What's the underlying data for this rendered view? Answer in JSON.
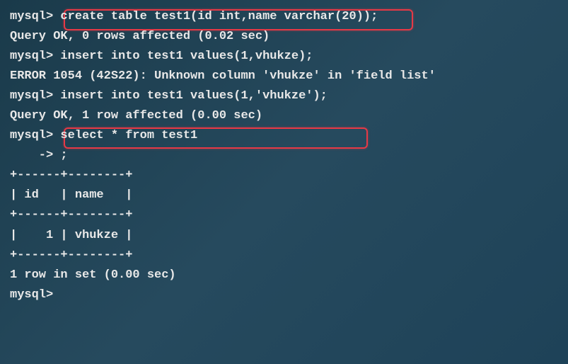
{
  "terminal": {
    "prompt": "mysql>",
    "cont_prompt": "    ->",
    "lines": {
      "l1_cmd": " create table test1(id int,name varchar(20));",
      "l2": "Query OK, 0 rows affected (0.02 sec)",
      "l3": "",
      "l4_cmd": " insert into test1 values(1,vhukze);",
      "l5": "ERROR 1054 (42S22): Unknown column 'vhukze' in 'field list'",
      "l6_cmd": " insert into test1 values(1,'vhukze');",
      "l7": "Query OK, 1 row affected (0.00 sec)",
      "l8": "",
      "l9_cmd": " select * from test1",
      "l10_cmd": " ;",
      "l11": "+------+--------+",
      "l12": "| id   | name   |",
      "l13": "+------+--------+",
      "l14": "|    1 | vhukze |",
      "l15": "+------+--------+",
      "l16": "1 row in set (0.00 sec)",
      "l17": "",
      "l18_partial": "mysql>"
    }
  }
}
